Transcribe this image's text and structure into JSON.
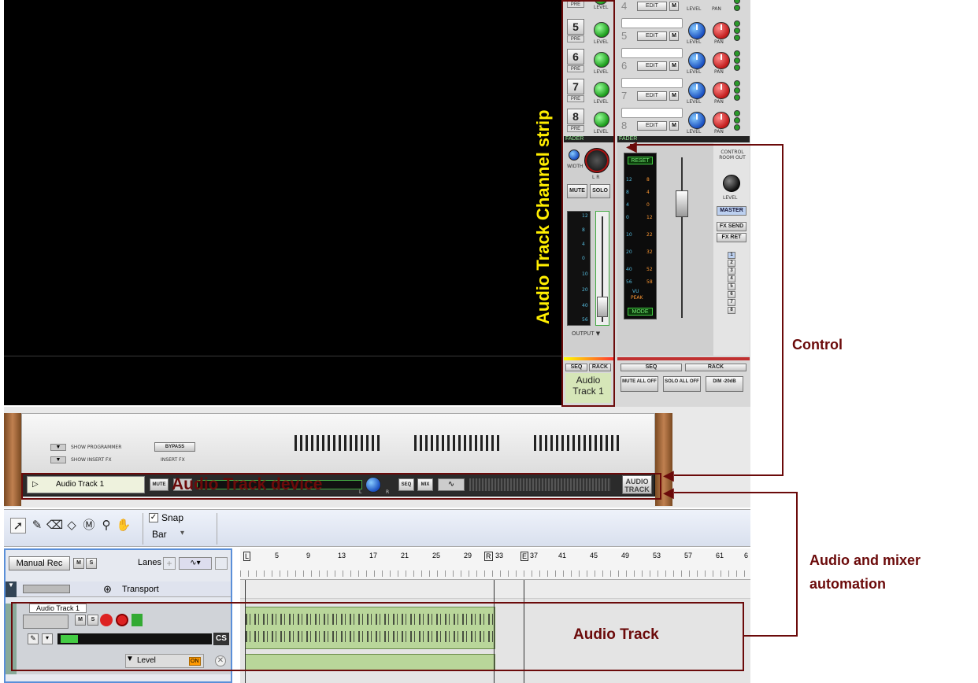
{
  "mixer": {
    "channels": [
      {
        "num": "5",
        "pre": "PRE",
        "level": "LEVEL"
      },
      {
        "num": "6",
        "pre": "PRE",
        "level": "LEVEL"
      },
      {
        "num": "7",
        "pre": "PRE",
        "level": "LEVEL"
      },
      {
        "num": "8",
        "pre": "PRE",
        "level": "LEVEL"
      }
    ],
    "top_partial": {
      "pre": "PRE",
      "level": "LEVEL",
      "num": "4",
      "edit": "EDIT",
      "m": "M",
      "level2": "LEVEL",
      "pan": "PAN"
    },
    "sends": [
      {
        "num": "5",
        "edit": "EDIT",
        "m": "M",
        "level": "LEVEL",
        "pan": "PAN"
      },
      {
        "num": "6",
        "edit": "EDIT",
        "m": "M",
        "level": "LEVEL",
        "pan": "PAN"
      },
      {
        "num": "7",
        "edit": "EDIT",
        "m": "M",
        "level": "LEVEL",
        "pan": "PAN"
      },
      {
        "num": "8",
        "edit": "EDIT",
        "m": "M",
        "level": "LEVEL",
        "pan": "PAN"
      }
    ],
    "fader_label": "FADER",
    "fader_label2": "FADER",
    "width": "WIDTH",
    "lr": "L        R",
    "mute": "MUTE",
    "solo": "SOLO",
    "meter_ticks": [
      "12",
      "8",
      "4",
      "0",
      "10",
      "20",
      "40",
      "56"
    ],
    "output": "OUTPUT ▼",
    "reset": "RESET",
    "vu_left": [
      "12",
      "8",
      "4",
      "0",
      "10",
      "20",
      "40",
      "56"
    ],
    "vu_right": [
      "8",
      "4",
      "0",
      "12",
      "22",
      "32",
      "52",
      "58"
    ],
    "vu": "VU",
    "peak": "PEAK",
    "mode": "MODE",
    "control_room": "CONTROL ROOM OUT",
    "cr_level": "LEVEL",
    "master": "MASTER",
    "fx_send": "FX SEND",
    "fx_ret": "FX RET",
    "fx_nums": [
      "1",
      "2",
      "3",
      "4",
      "5",
      "6",
      "7",
      "8"
    ],
    "seq": "SEQ",
    "rack": "RACK",
    "seq2": "SEQ",
    "rack2": "RACK",
    "track_name_line1": "Audio",
    "track_name_line2": "Track 1",
    "mute_all": "MUTE ALL OFF",
    "solo_all": "SOLO ALL OFF",
    "dim": "DIM -20dB"
  },
  "rack": {
    "show_programmer": "SHOW PROGRAMMER",
    "show_insert_fx": "SHOW INSERT FX",
    "bypass": "BYPASS",
    "insert_fx": "INSERT FX",
    "track_name": "Audio Track 1",
    "mute": "MUTE",
    "seq": "SEQ",
    "mix": "MIX",
    "logo_line1": "AUDIO",
    "logo_line2": "TRACK",
    "l": "L",
    "r": "R"
  },
  "toolbar": {
    "snap": "Snap",
    "bar": "Bar"
  },
  "tracklist": {
    "manual_rec": "Manual Rec",
    "m": "M",
    "s": "S",
    "lanes": "Lanes",
    "transport": "Transport",
    "audio_track": "Audio Track 1",
    "cs": "CS",
    "level": "Level",
    "on": "ON"
  },
  "ruler": {
    "bars": [
      "5",
      "9",
      "13",
      "17",
      "21",
      "25",
      "29",
      "33",
      "37",
      "41",
      "45",
      "49",
      "53",
      "57",
      "61",
      "6"
    ],
    "l_marker": "L",
    "r_marker": "R",
    "e_marker": "E"
  },
  "annotations": {
    "channel_strip": "Audio Track Channel strip",
    "control": "Control",
    "device": "Audio Track device",
    "automation_line1": "Audio and mixer",
    "automation_line2": "automation",
    "audio_track": "Audio Track"
  },
  "colors": {
    "annotation": "#6b0a0a",
    "channel_strip_label": "#ffee00",
    "selection_blue": "#5a8fd8"
  }
}
